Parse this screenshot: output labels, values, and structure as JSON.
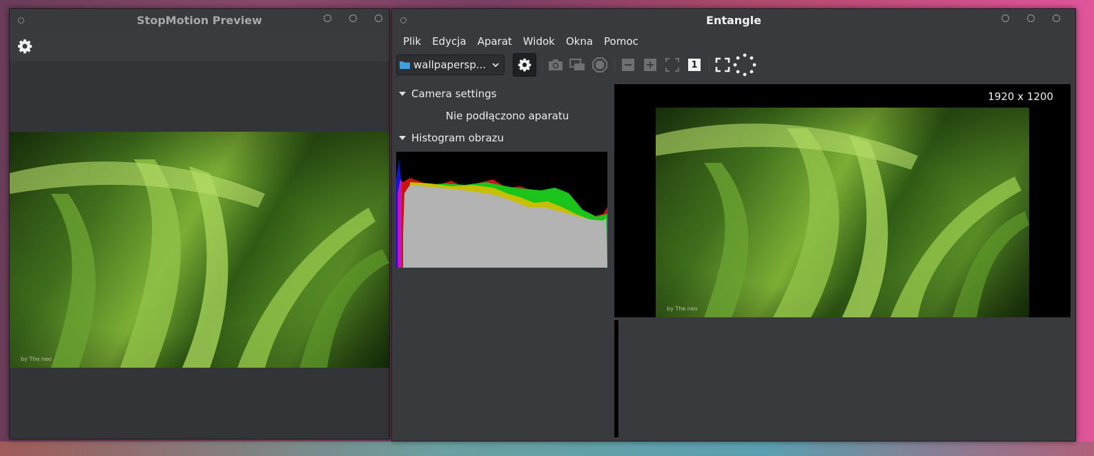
{
  "stopmotion": {
    "title": "StopMotion Preview",
    "settings_icon": "gear-icon",
    "preview_credit": "by The neo"
  },
  "entangle": {
    "title": "Entangle",
    "menu": [
      "Plik",
      "Edycja",
      "Aparat",
      "Widok",
      "Okna",
      "Pomoc"
    ],
    "session_combo": {
      "icon": "folder-icon",
      "value": "wallpapersp..."
    },
    "toolbar_icons": [
      "gear-icon",
      "camera-icon",
      "preview-icon",
      "cancel-icon",
      "zoom-out-icon",
      "zoom-in-icon",
      "zoom-fit-icon",
      "zoom-normal-icon",
      "fullscreen-icon",
      "spinner-icon"
    ],
    "zoom_normal_label": "1",
    "sections": {
      "camera_settings": "Camera settings",
      "no_camera": "Nie podłączono aparatu",
      "histogram": "Histogram obrazu"
    },
    "image_resolution": "1920 x 1200",
    "image_credit": "by The neo"
  },
  "colors": {
    "window_bg": "#393a3d",
    "histo_gray": "#b3b3b3",
    "histo_green": "#1bc41b",
    "histo_red": "#c81414",
    "histo_yellow": "#c6c000",
    "histo_blue": "#1414d0",
    "histo_magenta": "#c014c8"
  }
}
